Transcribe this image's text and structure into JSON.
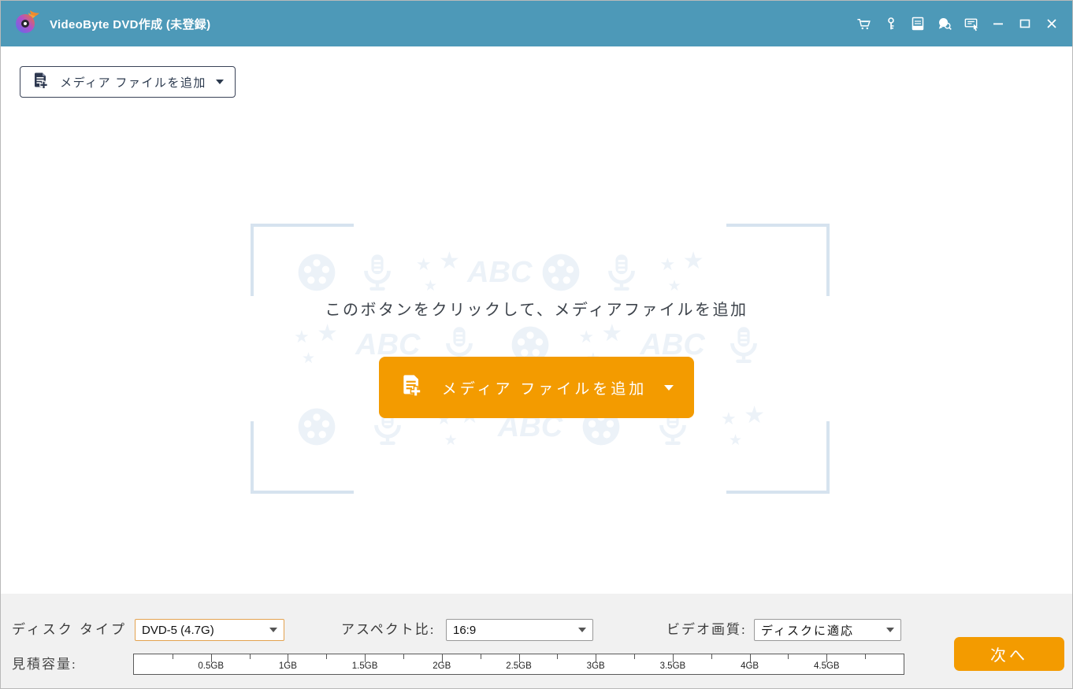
{
  "titlebar": {
    "title": "VideoByte DVD作成 (未登録)",
    "action_icons": [
      "cart-icon",
      "key-icon",
      "document-icon",
      "feedback-icon",
      "menu-select-icon"
    ],
    "window_controls": [
      "minimize",
      "maximize",
      "close"
    ]
  },
  "toolbar": {
    "add_media_label": "メディア ファイルを追加"
  },
  "dropzone": {
    "hint": "このボタンをクリックして、メディアファイルを追加",
    "add_media_label": "メディア ファイルを追加",
    "watermark_text": "ABC"
  },
  "settings": {
    "disc_type": {
      "label": "ディスク タイプ",
      "value": "DVD-5 (4.7G)"
    },
    "aspect_ratio": {
      "label": "アスペクト比:",
      "value": "16:9"
    },
    "video_quality": {
      "label": "ビデオ画質:",
      "value": "ディスクに適応"
    },
    "estimated_capacity_label": "見積容量:",
    "next_button_label": "次へ"
  },
  "capacity_ruler": {
    "range_gb": [
      0,
      5
    ],
    "minor_step_gb": 0.25,
    "tick_labels": [
      "0.5GB",
      "1GB",
      "1.5GB",
      "2GB",
      "2.5GB",
      "3GB",
      "3.5GB",
      "4GB",
      "4.5GB"
    ]
  },
  "colors": {
    "titlebar_background": "#4d99b8",
    "accent_orange": "#f39b00",
    "watermark_blue": "#ecf2f8",
    "watermark_bracket": "#d6e3ef",
    "panel_gray": "#f1f1f1",
    "disc_type_border": "#e3a24f"
  }
}
